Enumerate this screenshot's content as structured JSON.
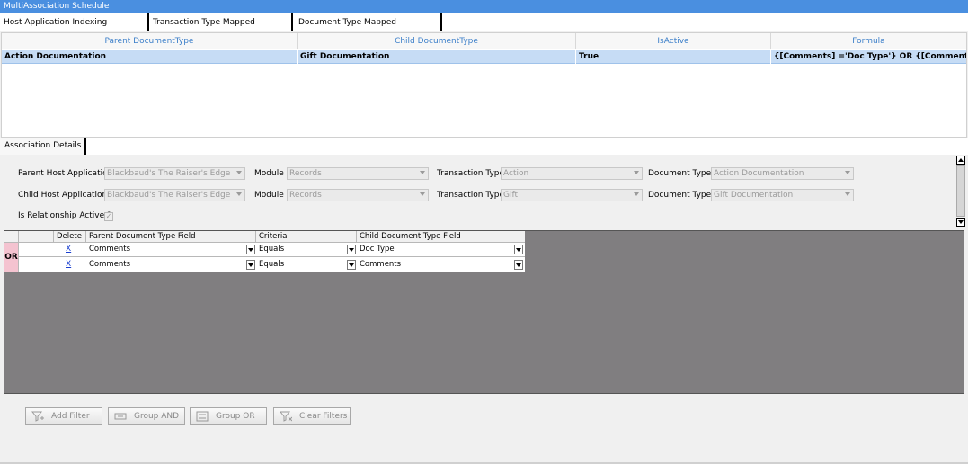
{
  "window": {
    "title": "MultiAssociation Schedule"
  },
  "tabs": [
    {
      "label": "Host Application Indexing Association"
    },
    {
      "label": "Transaction Type Mapped Association"
    },
    {
      "label": "Document Type Mapped Association"
    }
  ],
  "grid": {
    "columns": [
      "Parent DocumentType",
      "Child DocumentType",
      "IsActive",
      "Formula"
    ],
    "rows": [
      [
        "Action Documentation",
        "Gift Documentation",
        "True",
        "{[Comments] ='Doc Type'} OR {[Comments] ='..."
      ]
    ]
  },
  "details": {
    "tab_label": "Association Details",
    "parent_host_label": "Parent Host Application",
    "parent_host_value": "Blackbaud's The Raiser's Edge",
    "child_host_label": "Child Host Application",
    "child_host_value": "Blackbaud's The Raiser's Edge",
    "module_label": "Module",
    "parent_module_value": "Records",
    "child_module_value": "Records",
    "txn_label": "Transaction Type",
    "parent_txn_value": "Action",
    "child_txn_value": "Gift",
    "doc_label": "Document Type",
    "parent_doc_value": "Action Documentation",
    "child_doc_value": "Gift Documentation",
    "active_label": "Is Relationship Active ?",
    "active_check": "✓"
  },
  "filters": {
    "columns": [
      "Delete",
      "Parent Document Type Field",
      "Criteria",
      "Child Document Type Field"
    ],
    "group_label": "OR",
    "delete_glyph": "X",
    "rows": [
      {
        "parent": "Comments",
        "criteria": "Equals",
        "child": "Doc Type"
      },
      {
        "parent": "Comments",
        "criteria": "Equals",
        "child": "Comments"
      }
    ]
  },
  "buttons": {
    "add_filter": "Add Filter",
    "group_and": "Group AND",
    "group_or": "Group OR",
    "clear_filters": "Clear Filters"
  }
}
